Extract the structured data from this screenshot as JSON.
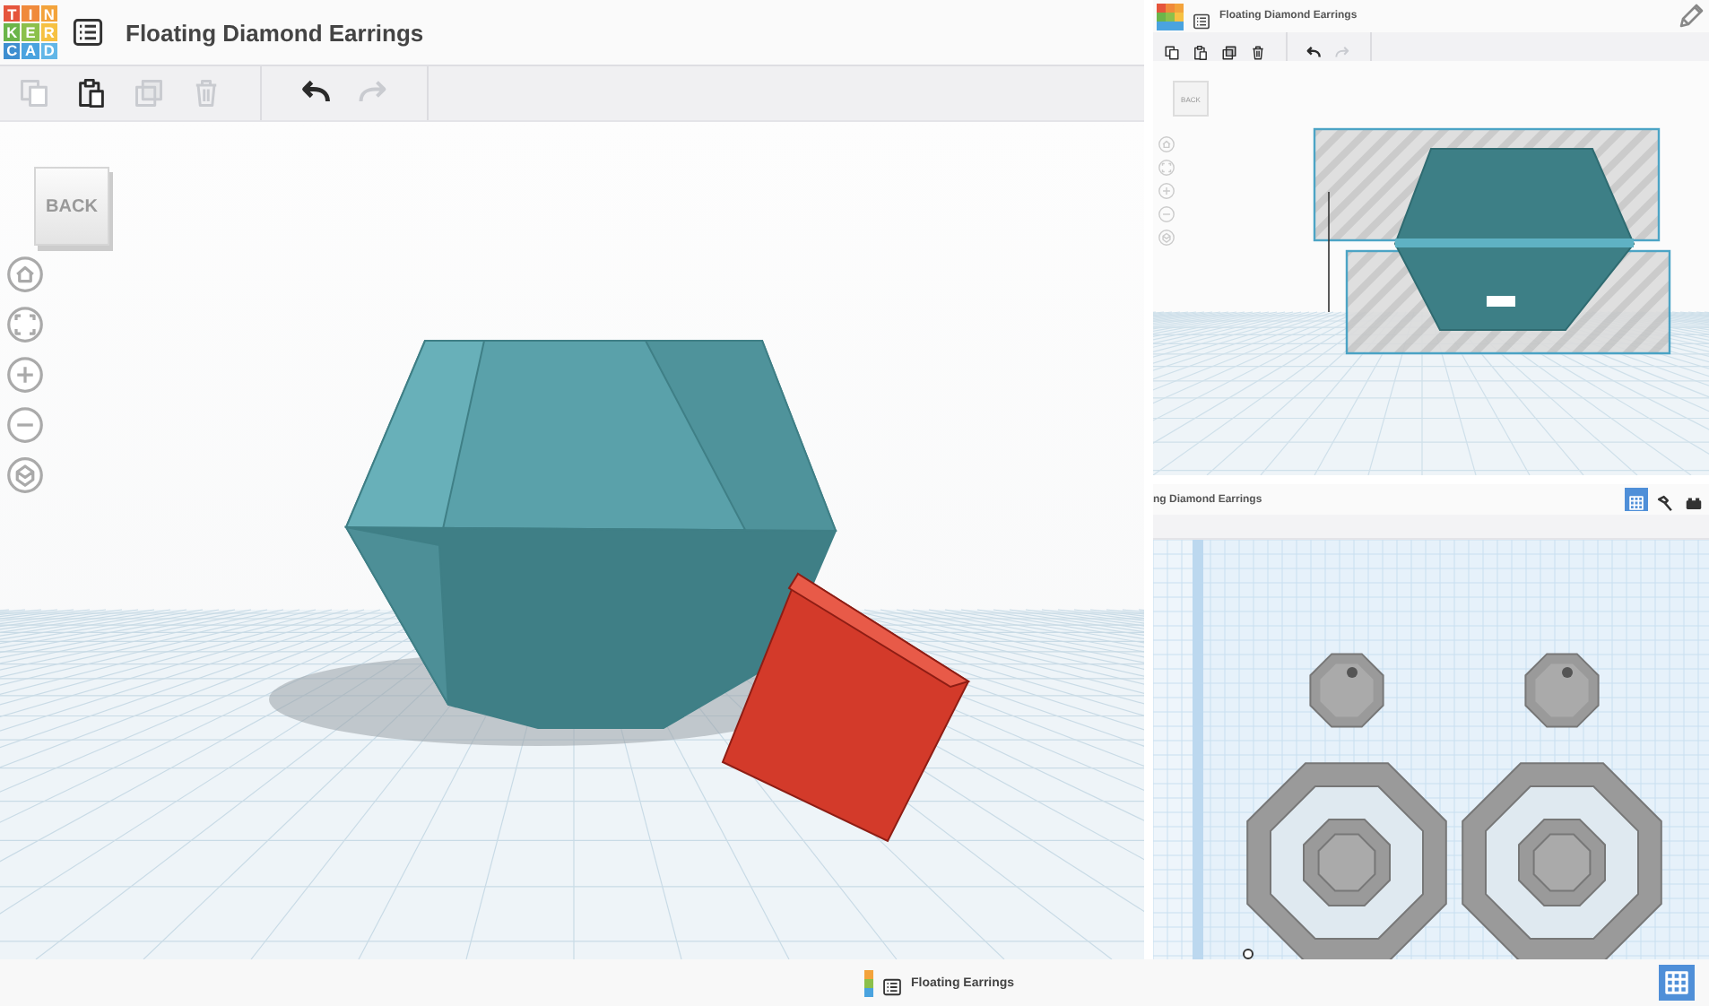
{
  "main": {
    "logo": [
      {
        "letter": "T",
        "color": "#e5553c"
      },
      {
        "letter": "I",
        "color": "#f08a3b"
      },
      {
        "letter": "N",
        "color": "#f3a33b"
      },
      {
        "letter": "K",
        "color": "#6bb54a"
      },
      {
        "letter": "E",
        "color": "#8cc04b"
      },
      {
        "letter": "R",
        "color": "#f6c142"
      },
      {
        "letter": "C",
        "color": "#3e8ed0"
      },
      {
        "letter": "A",
        "color": "#4aa3df"
      },
      {
        "letter": "D",
        "color": "#62b6e7"
      }
    ],
    "title": "Floating Diamond Earrings",
    "toolbar": [
      {
        "kind": "copy",
        "disabled": true
      },
      {
        "kind": "paste",
        "disabled": false
      },
      {
        "kind": "duplicate",
        "disabled": true
      },
      {
        "kind": "delete",
        "disabled": true
      },
      {
        "kind": "undo",
        "disabled": false
      },
      {
        "kind": "redo",
        "disabled": true
      }
    ],
    "back": "BACK",
    "view_controls": [
      {
        "kind": "home"
      },
      {
        "kind": "fit"
      },
      {
        "kind": "zoom_in"
      },
      {
        "kind": "zoom_out"
      },
      {
        "kind": "perspective"
      }
    ]
  },
  "top_right": {
    "title": "Floating Diamond Earrings",
    "toolbar": [
      {
        "kind": "copy",
        "disabled": false
      },
      {
        "kind": "paste",
        "disabled": false
      },
      {
        "kind": "duplicate",
        "disabled": false
      },
      {
        "kind": "delete",
        "disabled": false
      },
      {
        "kind": "undo",
        "disabled": false
      },
      {
        "kind": "redo",
        "disabled": true
      }
    ],
    "back": "BACK"
  },
  "bottom_right": {
    "title": "ng Diamond Earrings",
    "view_buttons": [
      {
        "kind": "grid",
        "selected": true
      },
      {
        "kind": "hammer",
        "selected": false
      },
      {
        "kind": "bricks",
        "selected": false
      }
    ]
  },
  "bottom_bar": {
    "title": "Floating Earrings",
    "view_buttons": [
      {
        "kind": "grid",
        "selected": true
      }
    ]
  }
}
